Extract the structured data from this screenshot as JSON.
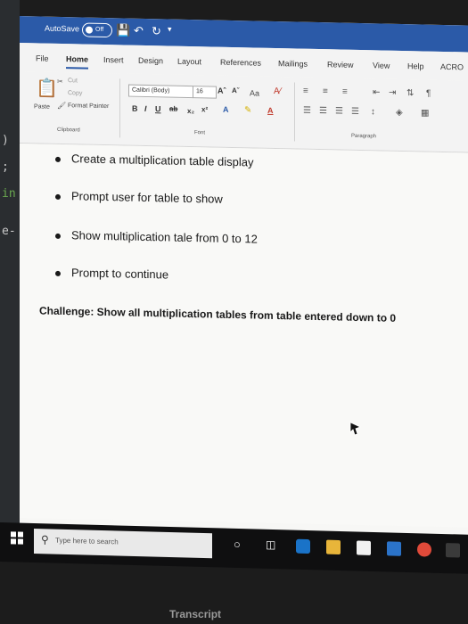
{
  "left_panel": {
    "code_lines": [
      ")",
      ";",
      "in",
      "e-"
    ]
  },
  "titlebar": {
    "autosave_label": "AutoSave",
    "autosave_state": "Off"
  },
  "ribbon_tabs": [
    "File",
    "Home",
    "Insert",
    "Design",
    "Layout",
    "References",
    "Mailings",
    "Review",
    "View",
    "Help",
    "ACRO"
  ],
  "active_tab": "Home",
  "clipboard": {
    "paste": "Paste",
    "cut": "Cut",
    "copy": "Copy",
    "format_painter": "Format Painter",
    "group_label": "Clipboard"
  },
  "font": {
    "name": "Calibri (Body)",
    "size": "16",
    "case_label": "Aa",
    "group_label": "Font"
  },
  "paragraph": {
    "group_label": "Paragraph"
  },
  "document": {
    "bullets": [
      "Create a multiplication table display",
      "Prompt user for table to show",
      "Show multiplication tale from 0 to 12",
      "Prompt to continue"
    ],
    "challenge": "Challenge: Show all multiplication tables from table entered down to 0"
  },
  "taskbar": {
    "search_placeholder": "Type here to search"
  },
  "caption": "Transcript",
  "colors": {
    "word_blue": "#2b5aa8",
    "taskbar": "#0f0f10"
  }
}
